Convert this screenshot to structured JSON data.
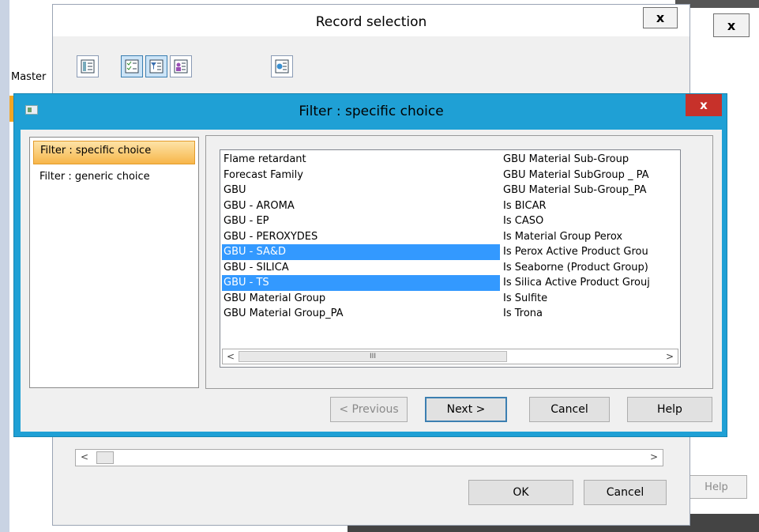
{
  "background_window": {
    "close_label": "x",
    "tab_label": "Master",
    "help_label": "Help"
  },
  "record_window": {
    "title": "Record selection",
    "close_label": "x",
    "ok_label": "OK",
    "cancel_label": "Cancel",
    "scroll_left": "<",
    "scroll_right": ">"
  },
  "filter_dialog": {
    "title": "Filter : specific choice",
    "close_label": "x",
    "nav_items": [
      {
        "label": "Filter : specific choice",
        "selected": true
      },
      {
        "label": "Filter : generic choice",
        "selected": false
      }
    ],
    "list_col1": [
      {
        "label": "Flame retardant",
        "selected": false
      },
      {
        "label": "Forecast Family",
        "selected": false
      },
      {
        "label": "GBU",
        "selected": false
      },
      {
        "label": "GBU - AROMA",
        "selected": false
      },
      {
        "label": "GBU - EP",
        "selected": false
      },
      {
        "label": "GBU - PEROXYDES",
        "selected": false
      },
      {
        "label": "GBU - SA&D",
        "selected": true
      },
      {
        "label": "GBU - SILICA",
        "selected": false
      },
      {
        "label": "GBU - TS",
        "selected": true
      },
      {
        "label": "GBU Material Group",
        "selected": false
      },
      {
        "label": "GBU Material Group_PA",
        "selected": false
      }
    ],
    "list_col2": [
      "GBU Material Sub-Group",
      "GBU Material SubGroup _ PA",
      "GBU Material Sub-Group_PA",
      "Is BICAR",
      "Is CASO",
      "Is Material Group Perox",
      "Is Perox Active Product Grou",
      "Is Seaborne (Product Group)",
      "Is Silica Active Product Grouj",
      "Is Sulfite",
      "Is Trona"
    ],
    "scroll_left": "<",
    "scroll_right": ">",
    "scroll_thumb": "III",
    "previous_label": "< Previous",
    "next_label": "Next >",
    "cancel_label": "Cancel",
    "help_label": "Help"
  },
  "colors": {
    "dialog_border": "#1fa0d5",
    "selection": "#3399ff",
    "nav_selected": "#f7b64a",
    "close_red": "#c7312a"
  }
}
